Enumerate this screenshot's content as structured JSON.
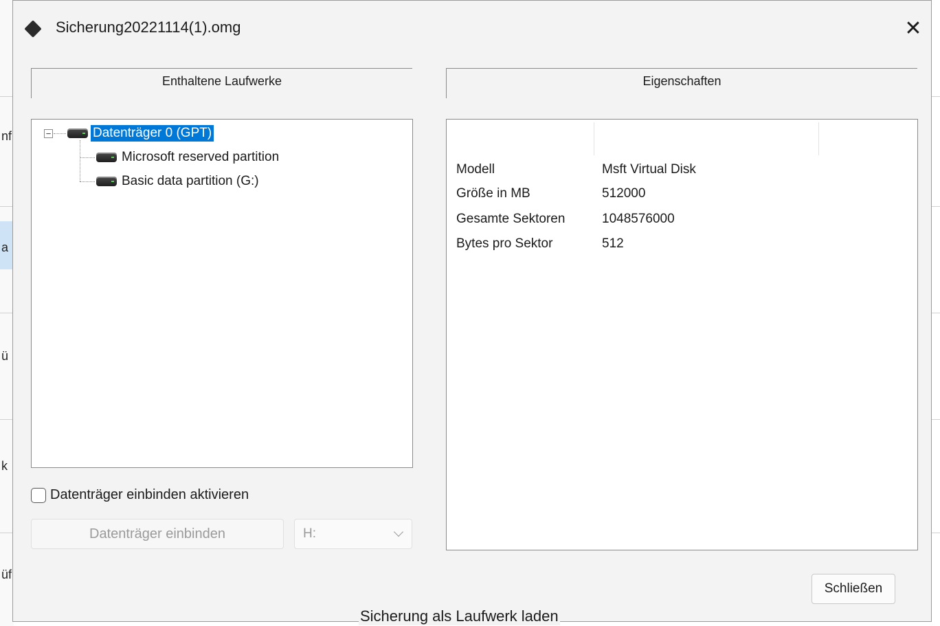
{
  "window": {
    "title": "Sicherung20221114(1).omg"
  },
  "background": {
    "left_glyphs": [
      "nf",
      "a",
      "ü",
      "k",
      "üf"
    ]
  },
  "left_panel": {
    "header": "Enthaltene Laufwerke",
    "tree": [
      {
        "label": "Datenträger 0 (GPT)",
        "selected": true,
        "expanded": true,
        "expander": "−"
      },
      {
        "label": "Microsoft reserved partition",
        "selected": false
      },
      {
        "label": "Basic data partition (G:)",
        "selected": false
      }
    ],
    "mount_checkbox": {
      "label": "Datenträger einbinden aktivieren",
      "checked": false
    },
    "mount_button": {
      "label": "Datenträger einbinden",
      "enabled": false
    },
    "drive_select": {
      "value": "H:",
      "enabled": false
    }
  },
  "right_panel": {
    "header": "Eigenschaften",
    "properties": [
      {
        "key": "Modell",
        "value": "Msft Virtual Disk"
      },
      {
        "key": "Größe in MB",
        "value": "512000"
      },
      {
        "key": "Gesamte Sektoren",
        "value": "1048576000"
      },
      {
        "key": "Bytes pro Sektor",
        "value": "512"
      }
    ]
  },
  "footer": {
    "close_label": "Schließen",
    "status": "Sicherung als Laufwerk laden"
  },
  "colors": {
    "selection": "#0078d7",
    "dialog_bg": "#f3f3f3"
  }
}
